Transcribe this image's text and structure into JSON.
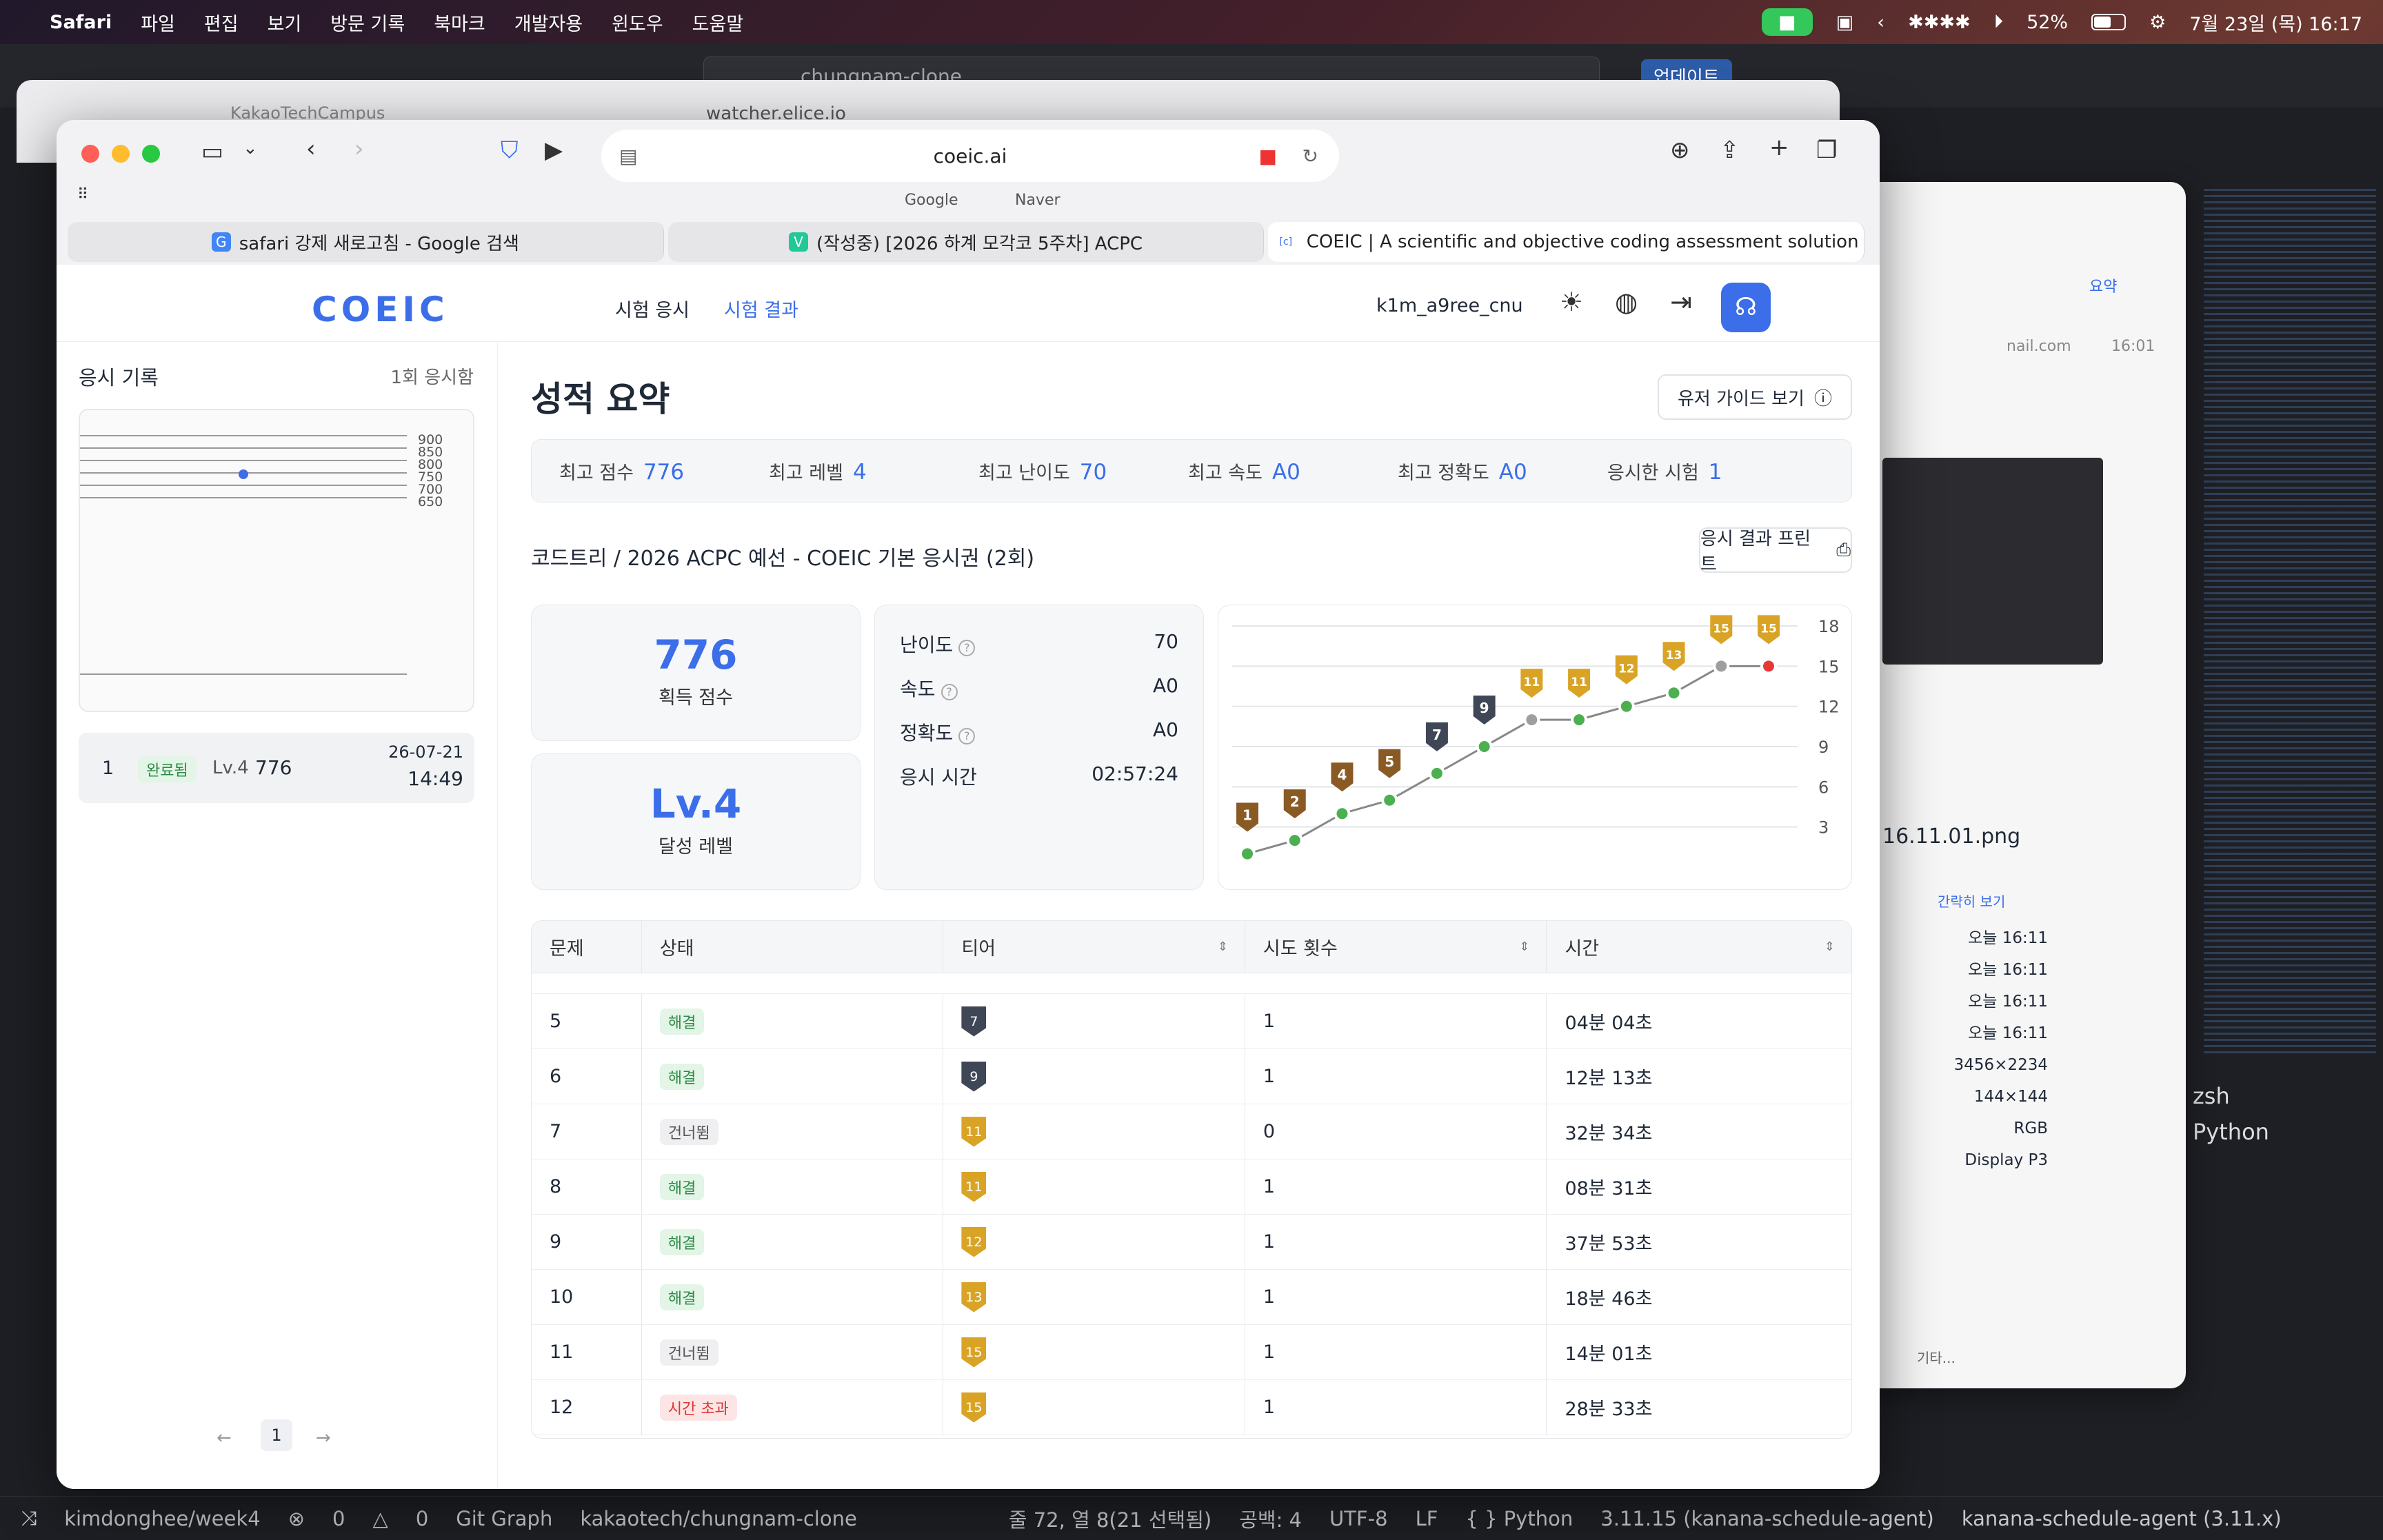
{
  "menubar": {
    "apple": "",
    "app": "Safari",
    "items": [
      "파일",
      "편집",
      "보기",
      "방문 기록",
      "북마크",
      "개발자용",
      "윈도우",
      "도움말"
    ],
    "battery": "52%",
    "datetime": "7월 23일 (목) 16:17"
  },
  "vscode": {
    "search": "chungnam-clone",
    "update": "업데이트",
    "terminal_shell": "zsh",
    "terminal_python": "Python",
    "status": {
      "branch": "kimdonghee/week4",
      "errors": "0",
      "warnings": "0",
      "git_graph": "Git Graph",
      "folder": "kakaotech/chungnam-clone",
      "position": "줄 72, 열 8(21 선택됨)",
      "spaces": "공백: 4",
      "encoding": "UTF-8",
      "eol": "LF",
      "language": "{ } Python",
      "interpreter": "3.11.15 (kanana-schedule-agent)",
      "env": "kanana-schedule-agent (3.11.x)"
    }
  },
  "bg_elice": {
    "tab": "KakaoTechCampus",
    "url": "watcher.elice.io"
  },
  "bg_photo": {
    "summary": "요약",
    "mail": "nail.com",
    "mail_time": "16:01",
    "filename": "16.11.01.png",
    "brief": "간략히 보기",
    "times": [
      "오늘 16:11",
      "오늘 16:11",
      "오늘 16:11",
      "오늘 16:11"
    ],
    "dims": "3456×2234",
    "dpi": "144×144",
    "color": "RGB",
    "profile": "Display P3",
    "other": "기타..."
  },
  "safari": {
    "url": "coeic.ai",
    "bookmarks": [
      "Google",
      "Naver"
    ],
    "tabs": [
      {
        "icon": "G",
        "label": "safari 강제 새로고침 - Google 검색"
      },
      {
        "icon": "V",
        "label": "(작성중) [2026 하계 모각코 5주차] ACPC"
      },
      {
        "icon": "[c]",
        "label": "COEIC | A scientific and objective coding assessment solution"
      }
    ]
  },
  "site": {
    "logo": "COEIC",
    "nav": [
      "시험 응시",
      "시험 결과"
    ],
    "user": "k1m_a9ree_cnu",
    "sidebar": {
      "title": "응시 기록",
      "count": "1회 응시함",
      "mini_ticks": [
        "900",
        "850",
        "800",
        "750",
        "700",
        "650"
      ],
      "entry": {
        "num": "1",
        "status": "완료됨",
        "level": "Lv.4",
        "score": "776",
        "date": "26-07-21",
        "time": "14:49"
      },
      "page": "1"
    },
    "summary": {
      "title": "성적 요약",
      "guide": "유저 가이드 보기",
      "stats": [
        {
          "label": "최고 점수",
          "value": "776"
        },
        {
          "label": "최고 레벨",
          "value": "4"
        },
        {
          "label": "최고 난이도",
          "value": "70"
        },
        {
          "label": "최고 속도",
          "value": "A0"
        },
        {
          "label": "최고 정확도",
          "value": "A0"
        },
        {
          "label": "응시한 시험",
          "value": "1"
        }
      ]
    },
    "exam": {
      "title": "코드트리 / 2026 ACPC 예선 - COEIC 기본 응시권 (2회)",
      "print": "응시 결과 프린트",
      "score": "776",
      "score_label": "획득 점수",
      "level": "Lv.4",
      "level_label": "달성 레벨",
      "details": [
        {
          "label": "난이도",
          "value": "70",
          "help": true
        },
        {
          "label": "속도",
          "value": "A0",
          "help": true
        },
        {
          "label": "정확도",
          "value": "A0",
          "help": true
        },
        {
          "label": "응시 시간",
          "value": "02:57:24",
          "help": false
        }
      ]
    },
    "table": {
      "headers": [
        "문제",
        "상태",
        "티어",
        "시도 횟수",
        "시간"
      ],
      "rows": [
        {
          "num": "5",
          "status": "해결",
          "tier": "7",
          "attempts": "1",
          "time": "04분 04초"
        },
        {
          "num": "6",
          "status": "해결",
          "tier": "9",
          "attempts": "1",
          "time": "12분 13초"
        },
        {
          "num": "7",
          "status": "건너뜀",
          "tier": "11",
          "attempts": "0",
          "time": "32분 34초"
        },
        {
          "num": "8",
          "status": "해결",
          "tier": "11",
          "attempts": "1",
          "time": "08분 31초"
        },
        {
          "num": "9",
          "status": "해결",
          "tier": "12",
          "attempts": "1",
          "time": "37분 53초"
        },
        {
          "num": "10",
          "status": "해결",
          "tier": "13",
          "attempts": "1",
          "time": "18분 46초"
        },
        {
          "num": "11",
          "status": "건너뜀",
          "tier": "15",
          "attempts": "1",
          "time": "14분 01초"
        },
        {
          "num": "12",
          "status": "시간 초과",
          "tier": "15",
          "attempts": "1",
          "time": "28분 33초"
        }
      ]
    }
  },
  "chart_data": {
    "type": "line",
    "x": [
      1,
      2,
      3,
      4,
      5,
      6,
      7,
      8,
      9,
      10,
      11,
      12
    ],
    "values": [
      1,
      2,
      4,
      5,
      7,
      9,
      11,
      11,
      12,
      13,
      15,
      15
    ],
    "point_status": [
      "solved",
      "solved",
      "solved",
      "solved",
      "solved",
      "solved",
      "skipped",
      "solved",
      "solved",
      "solved",
      "skipped",
      "timeout"
    ],
    "ylim": [
      0,
      18
    ],
    "yticks": [
      3,
      6,
      9,
      12,
      15,
      18
    ],
    "grid": true
  },
  "colors": {
    "accent": "#3b6ee8",
    "bronze": "#8a5a24",
    "silver": "#3f4756",
    "gold": "#d9a426",
    "solved": "#4caf50",
    "skipped": "#9e9e9e",
    "timeout": "#e53935"
  }
}
